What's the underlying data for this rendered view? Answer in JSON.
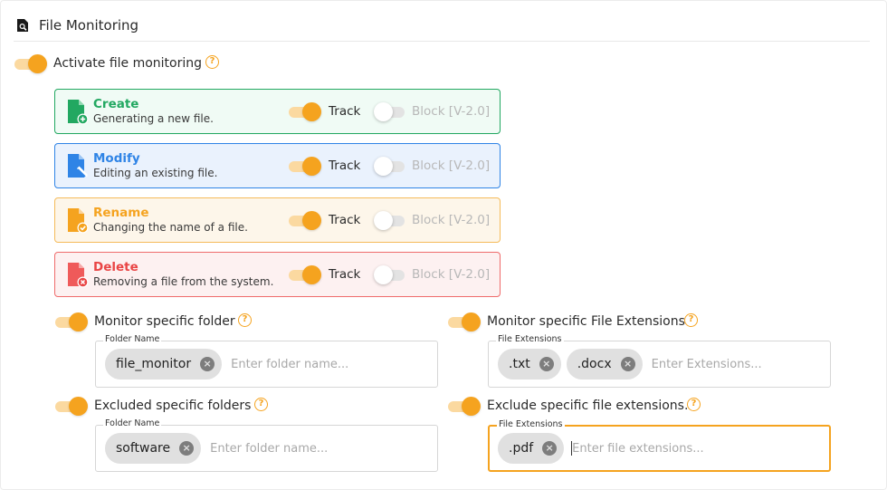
{
  "header": {
    "title": "File Monitoring",
    "icon": "document-search-icon"
  },
  "activate": {
    "label": "Activate file monitoring",
    "enabled": true
  },
  "actions": [
    {
      "key": "create",
      "title": "Create",
      "description": "Generating a new file.",
      "track_label": "Track",
      "block_label": "Block [V-2.0]",
      "track": true,
      "block": false,
      "color": "#22a861"
    },
    {
      "key": "modify",
      "title": "Modify",
      "description": "Editing an existing file.",
      "track_label": "Track",
      "block_label": "Block [V-2.0]",
      "track": true,
      "block": false,
      "color": "#2f84e6"
    },
    {
      "key": "rename",
      "title": "Rename",
      "description": "Changing the name of a file.",
      "track_label": "Track",
      "block_label": "Block [V-2.0]",
      "track": true,
      "block": false,
      "color": "#f5a31f"
    },
    {
      "key": "delete",
      "title": "Delete",
      "description": "Removing a file from the system.",
      "track_label": "Track",
      "block_label": "Block [V-2.0]",
      "track": true,
      "block": false,
      "color": "#e94545"
    }
  ],
  "monitor_folder": {
    "label": "Monitor specific folder",
    "enabled": true,
    "field_label": "Folder Name",
    "chips": [
      "file_monitor"
    ],
    "placeholder": "Enter folder name..."
  },
  "monitor_extensions": {
    "label": "Monitor specific File Extensions",
    "enabled": true,
    "field_label": "File Extensions",
    "chips": [
      ".txt",
      ".docx"
    ],
    "placeholder": "Enter Extensions..."
  },
  "excluded_folders": {
    "label": "Excluded specific folders",
    "enabled": true,
    "field_label": "Folder Name",
    "chips": [
      "software"
    ],
    "placeholder": "Enter folder name..."
  },
  "excluded_extensions": {
    "label": "Exclude specific file extensions.",
    "enabled": true,
    "field_label": "File Extensions",
    "chips": [
      ".pdf"
    ],
    "placeholder": "Enter file extensions..."
  },
  "theme": {
    "accent": "#f5a31f"
  }
}
